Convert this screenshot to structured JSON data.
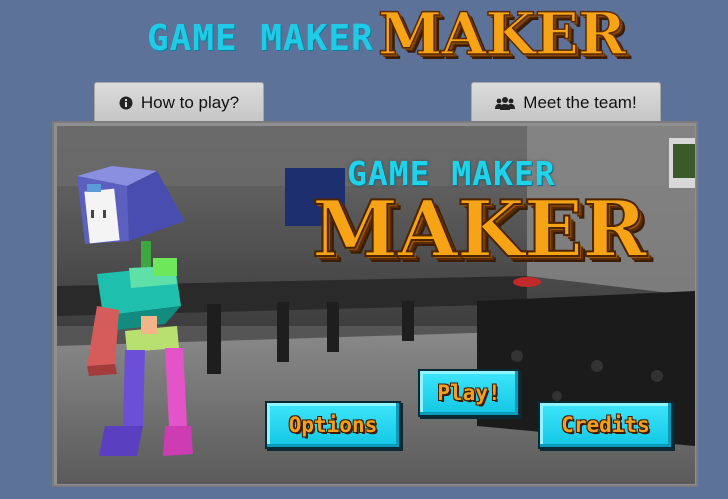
{
  "header": {
    "logo_small": "GAME MAKER",
    "logo_big": "MAKER"
  },
  "tabs": [
    {
      "label": "How to play?",
      "icon": "info-circle-icon"
    },
    {
      "label": "Meet the team!",
      "icon": "users-icon"
    }
  ],
  "game": {
    "logo_small": "GAME MAKER",
    "logo_big": "MAKER",
    "menu": {
      "play": "Play!",
      "options": "Options",
      "credits": "Credits"
    }
  },
  "colors": {
    "page_background": "#5d7299",
    "logo_cyan": "#1fcbe6",
    "logo_orange": "#f6a316",
    "button_cyan": "#2ad8f2",
    "button_text": "#f4a01e",
    "tab_grey": "#d2d2d2"
  }
}
